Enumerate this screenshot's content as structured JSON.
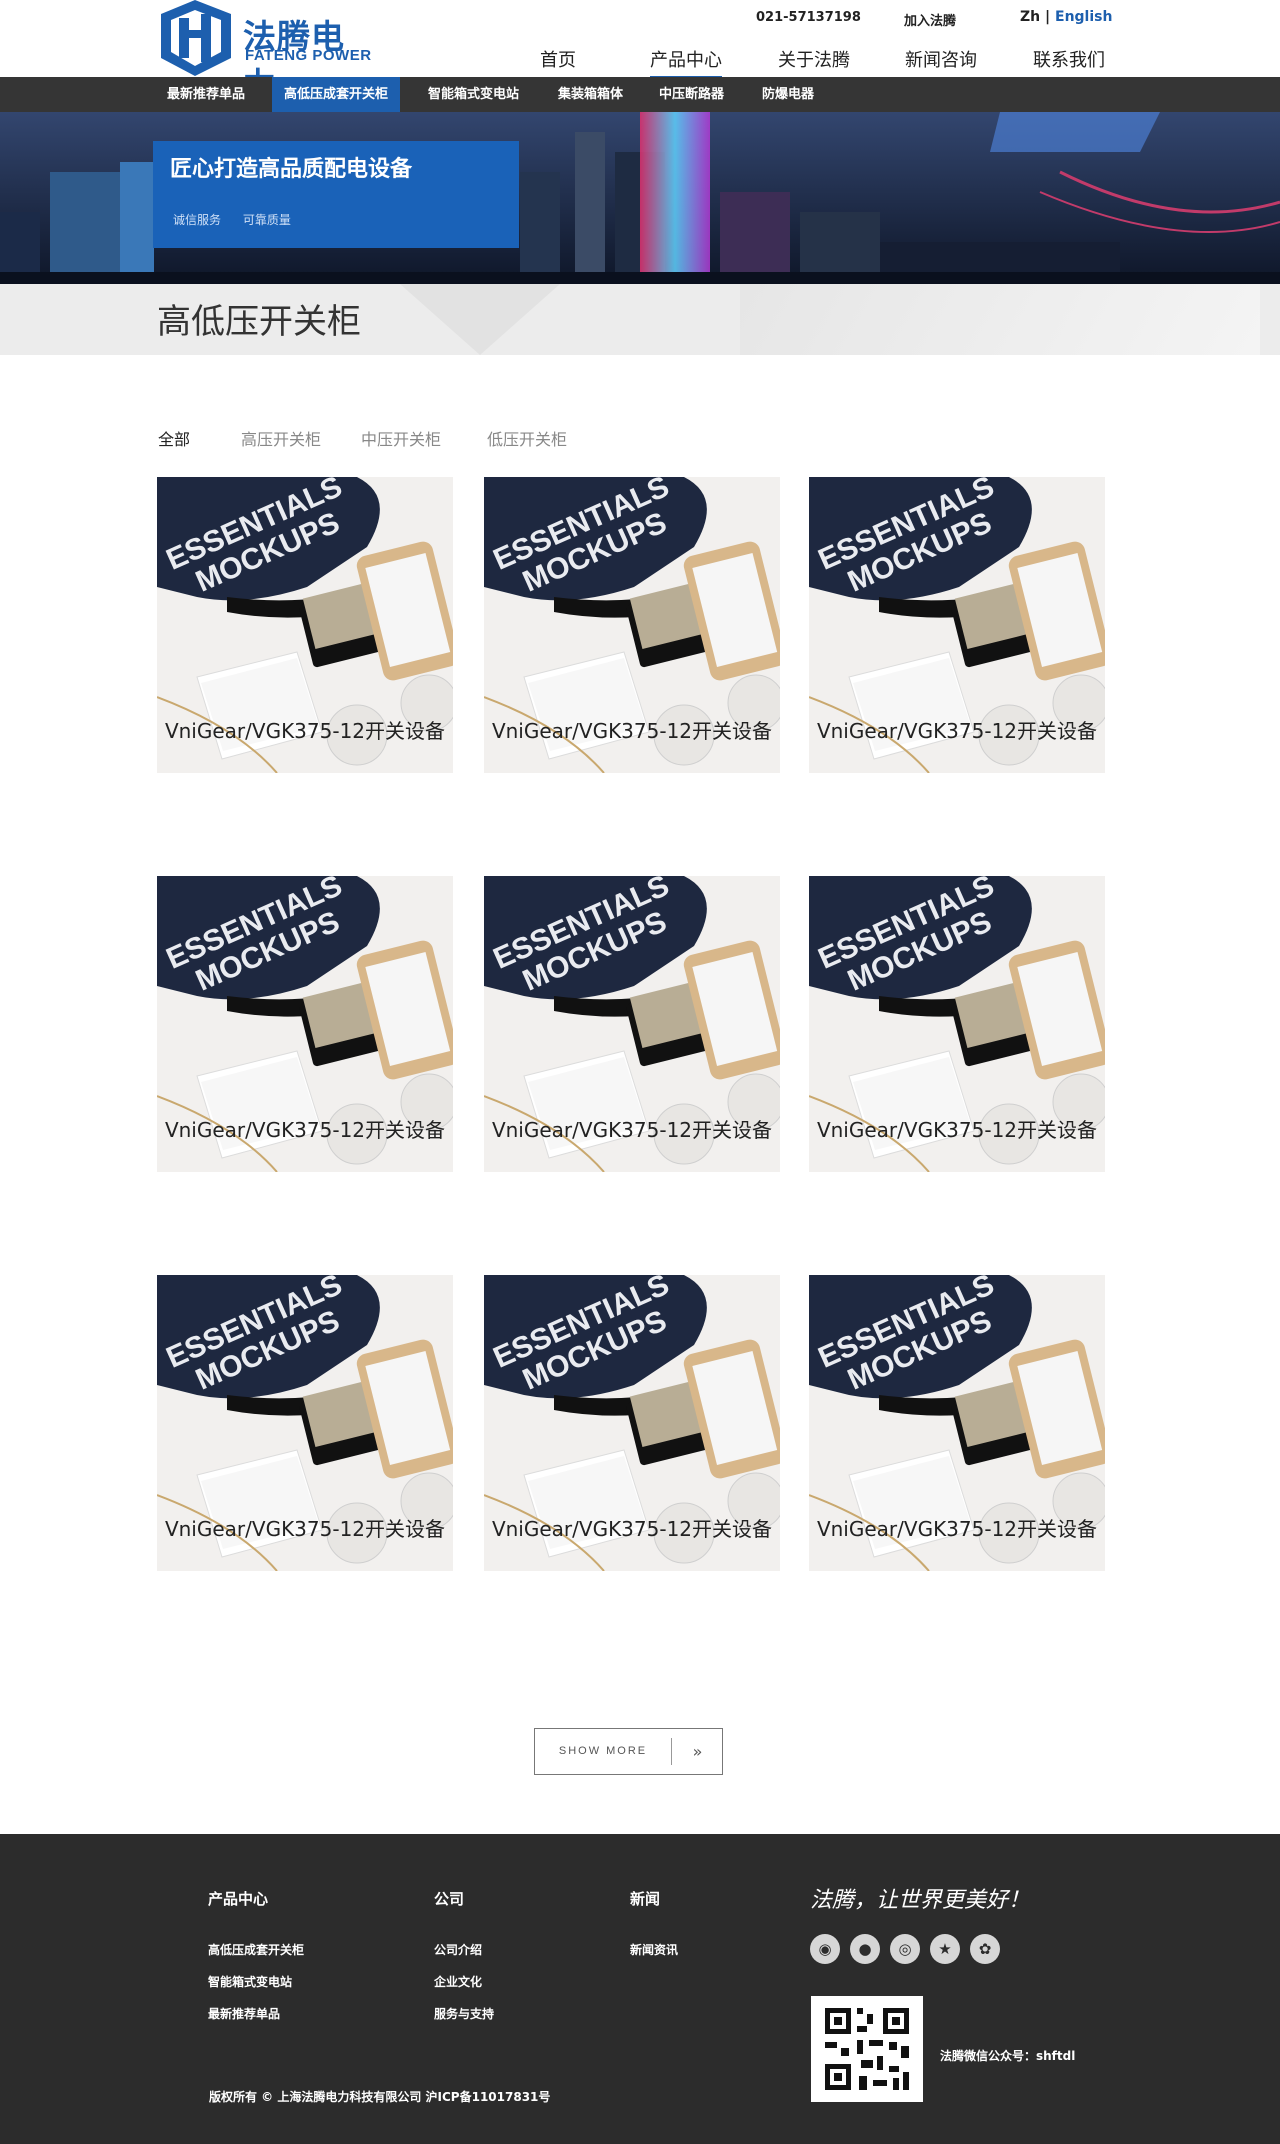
{
  "header": {
    "logo_zh": "法腾电力",
    "logo_en": "FATENG POWER",
    "phone": "021-57137198",
    "join": "加入法腾",
    "lang_zh": "Zh",
    "lang_sep": "|",
    "lang_en": "English"
  },
  "nav": {
    "items": [
      "首页",
      "产品中心",
      "关于法腾",
      "新闻咨询",
      "联系我们"
    ],
    "active": "产品中心"
  },
  "subnav": {
    "items": [
      "最新推荐单品",
      "高低压成套开关柜",
      "智能箱式变电站",
      "集装箱箱体",
      "中压断路器",
      "防爆电器"
    ],
    "active": "高低压成套开关柜"
  },
  "banner": {
    "title": "匠心打造高品质配电设备",
    "tags": [
      "诚信服务",
      "可靠质量"
    ]
  },
  "page_title": "高低压开关柜",
  "filters": [
    "全部",
    "高压开关柜",
    "中压开关柜",
    "低压开关柜"
  ],
  "products": [
    {
      "name": "VniGear/VGK375-12开关设备"
    },
    {
      "name": "VniGear/VGK375-12开关设备"
    },
    {
      "name": "VniGear/VGK375-12开关设备"
    },
    {
      "name": "VniGear/VGK375-12开关设备"
    },
    {
      "name": "VniGear/VGK375-12开关设备"
    },
    {
      "name": "VniGear/VGK375-12开关设备"
    },
    {
      "name": "VniGear/VGK375-12开关设备"
    },
    {
      "name": "VniGear/VGK375-12开关设备"
    },
    {
      "name": "VniGear/VGK375-12开关设备"
    }
  ],
  "mockup_text": [
    "ESSENTIALS",
    "MOCKUPS"
  ],
  "show_more": "SHOW MORE",
  "footer": {
    "col1": {
      "title": "产品中心",
      "items": [
        "高低压成套开关柜",
        "智能箱式变电站",
        "最新推荐单品"
      ]
    },
    "col2": {
      "title": "公司",
      "items": [
        "公司介绍",
        "企业文化",
        "服务与支持"
      ]
    },
    "col3": {
      "title": "新闻",
      "items": [
        "新闻资讯"
      ]
    },
    "slogan": "法腾，让世界更美好！",
    "wechat": "法腾微信公众号：shftdl",
    "copyright": "版权所有 © 上海法腾电力科技有限公司 沪ICP备11017831号",
    "social_icons": [
      "qq-icon",
      "wechat-icon",
      "weibo-icon",
      "star-icon",
      "baidu-icon"
    ]
  },
  "colors": {
    "brand": "#1d5fae",
    "dark": "#353535",
    "footer": "#2c2c2c"
  }
}
